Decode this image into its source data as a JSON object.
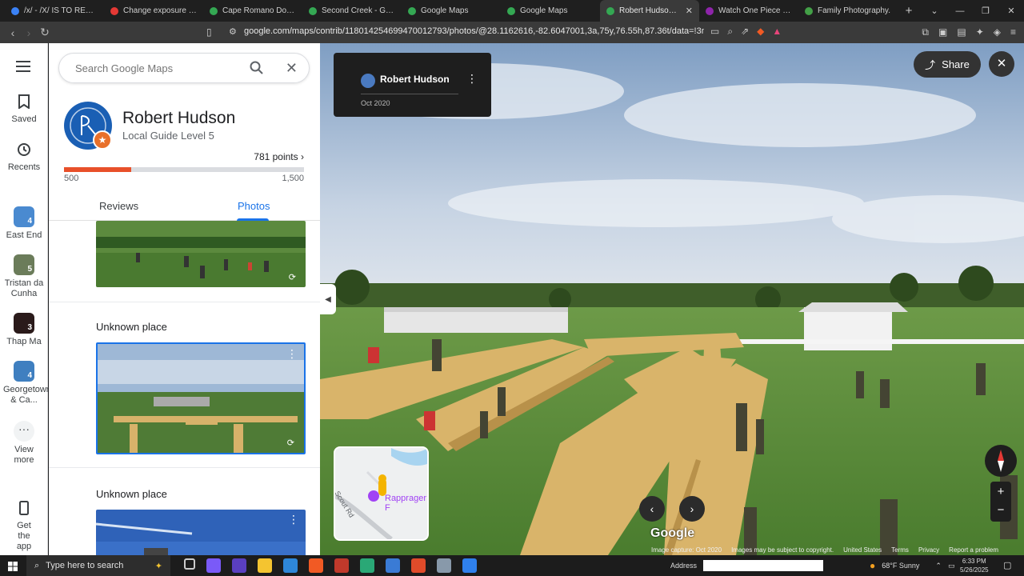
{
  "browser": {
    "tabs": [
      {
        "label": "/x/ - /X/ IS TO RETARDED",
        "color": "#3b82f6"
      },
      {
        "label": "Change exposure online",
        "color": "#e53935"
      },
      {
        "label": "Cape Romano Dome Hou",
        "color": "#34a853"
      },
      {
        "label": "Second Creek - Google M",
        "color": "#34a853"
      },
      {
        "label": "Google Maps",
        "color": "#34a853"
      },
      {
        "label": "Google Maps",
        "color": "#34a853"
      },
      {
        "label": "Robert Hudson - Go",
        "color": "#34a853",
        "active": true
      },
      {
        "label": "Watch One Piece Episode",
        "color": "#8e24aa"
      },
      {
        "label": "Family Photography.",
        "color": "#43a047"
      }
    ],
    "new_tab": "+",
    "url": "google.com/maps/contrib/118014254699470012793/photos/@28.1162616,-82.6047001,3a,75y,76.55h,87.36t/data=!3m7!1e1!3m5!1sClH..."
  },
  "rail": {
    "menu_icon": "menu-icon",
    "items": [
      {
        "label": "Saved",
        "icon": "bookmark-icon"
      },
      {
        "label": "Recents",
        "icon": "history-icon"
      },
      {
        "label": "East End",
        "count": "4",
        "color": "#4a8ad0"
      },
      {
        "label": "Tristan da Cunha",
        "count": "5",
        "color": "#6b7c5a"
      },
      {
        "label": "Thap Ma",
        "count": "3",
        "color": "#2a1a1a"
      },
      {
        "label": "Georgetown & Ca...",
        "count": "4",
        "color": "#3f7fc0"
      },
      {
        "label": "View more",
        "icon": "more-icon"
      },
      {
        "label": "Get the app",
        "icon": "phone-icon"
      }
    ]
  },
  "search": {
    "placeholder": "Search Google Maps"
  },
  "profile": {
    "name": "Robert Hudson",
    "level": "Local Guide Level 5",
    "points": "781 points",
    "progress_fraction": 0.281,
    "min_label": "500",
    "max_label": "1,500"
  },
  "tabs": {
    "reviews": "Reviews",
    "photos": "Photos"
  },
  "photos": [
    {
      "title": "Unknown place"
    },
    {
      "title": "Unknown place"
    }
  ],
  "streetview": {
    "card_name": "Robert Hudson",
    "card_date": "Oct 2020",
    "share_label": "Share",
    "minimap_road": "Scout Rd",
    "minimap_place": "Rapprager F",
    "google_logo": "Google",
    "footer": {
      "capture": "Image capture: Oct 2020",
      "copyright": "Images may be subject to copyright.",
      "country": "United States",
      "terms": "Terms",
      "privacy": "Privacy",
      "report": "Report a problem"
    }
  },
  "taskbar": {
    "search_placeholder": "Type here to search",
    "address_label": "Address",
    "weather": "68°F  Sunny",
    "time": "6:33 PM",
    "date": "5/26/2025"
  }
}
